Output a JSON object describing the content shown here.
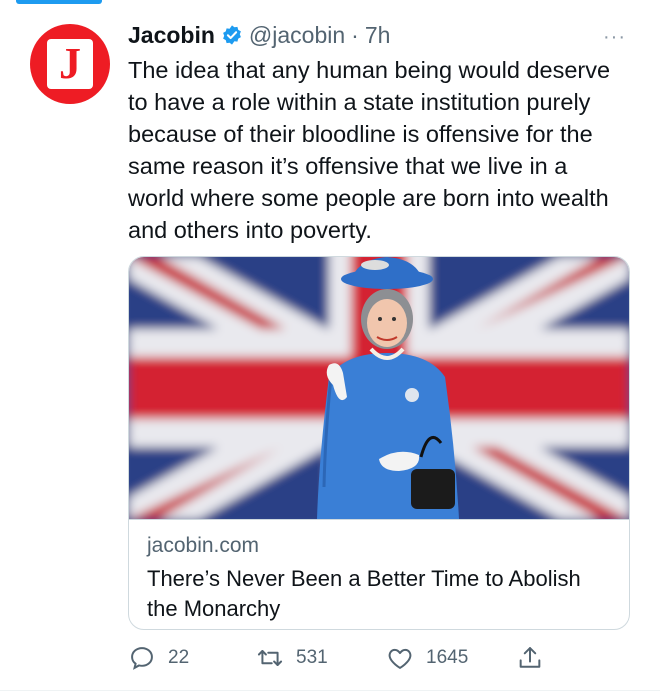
{
  "tweet": {
    "author_name": "Jacobin",
    "handle": "@jacobin",
    "separator": "·",
    "time": "7h",
    "avatar_letter": "J",
    "more_label": "···",
    "text": "The idea that any human being would deserve to have a role within a state institution purely because of their bloodline is offensive for the same reason it’s offensive that we live in a world where some people are born into wealth and others into poverty."
  },
  "card": {
    "domain": "jacobin.com",
    "title": "There’s Never Been a Better Time to Abolish the Monarchy"
  },
  "actions": {
    "replies": "22",
    "retweets": "531",
    "likes": "1645"
  },
  "colors": {
    "brand_red": "#ee1c24",
    "accent_blue": "#1d9bf0",
    "muted_text": "#536471"
  },
  "icons": [
    "verified-badge-icon",
    "more-options-icon",
    "reply-icon",
    "retweet-icon",
    "like-icon",
    "share-icon"
  ]
}
